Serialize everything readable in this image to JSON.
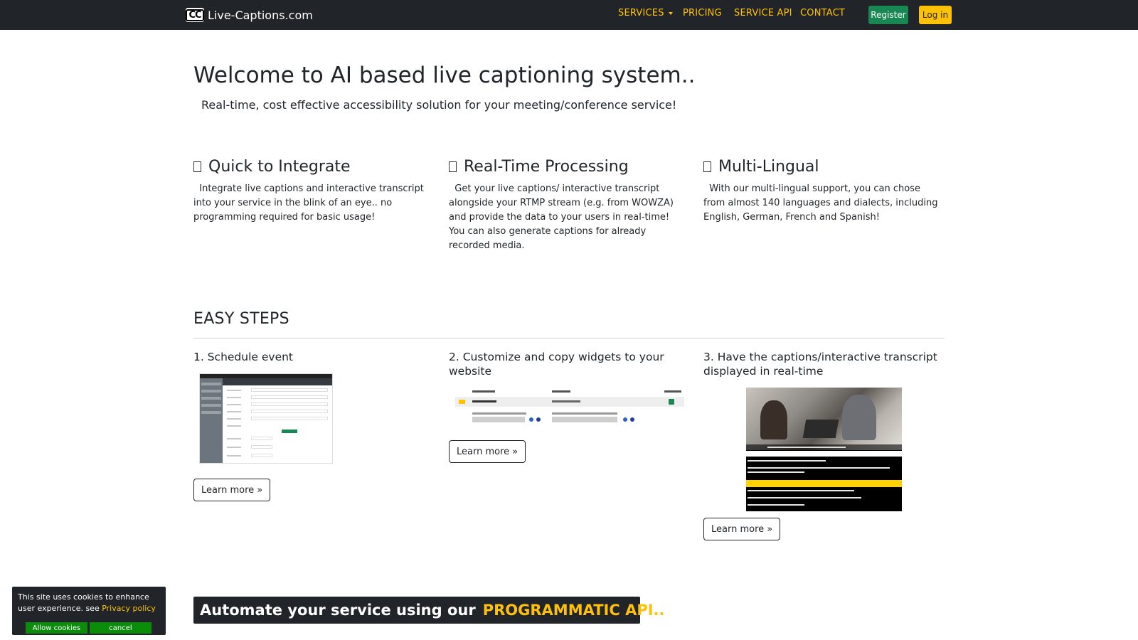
{
  "navbar": {
    "brand_logo": "CC",
    "brand": "Live-Captions.com",
    "links": {
      "services": "SERVICES",
      "pricing": "PRICING",
      "service_api": "SERVICE API",
      "contact": "CONTACT"
    },
    "register": "Register",
    "login": "Log in"
  },
  "hero": {
    "title": "Welcome to AI based live captioning system..",
    "subtitle": "Real-time, cost effective accessibility solution for your meeting/conference service!"
  },
  "features": [
    {
      "title": "Quick to Integrate",
      "text": "  Integrate live captions and interactive transcript into your service in the blink of an eye.. no programming required for basic usage!"
    },
    {
      "title": "Real-Time Processing",
      "text": "  Get your live captions/ interactive transcript alongside your RTMP stream (e.g. from WOWZA) and provide the data to your users in real-time! You can also generate captions for already recorded media."
    },
    {
      "title": "Multi-Lingual",
      "text": "  With our multi-lingual support, you can chose from almost 140 languages and dialects, including English, German, French and Spanish!"
    }
  ],
  "steps": {
    "title": "EASY STEPS",
    "items": [
      {
        "title": "1. Schedule event",
        "button": "Learn more »"
      },
      {
        "title": "2. Customize and copy widgets to your website",
        "button": "Learn more »"
      },
      {
        "title": "3. Have the captions/interactive transcript displayed in real-time",
        "button": "Learn more »"
      }
    ]
  },
  "api_banner": {
    "prefix": "Automate your service using our",
    "highlight": "PROGRAMMATIC API.."
  },
  "cookie": {
    "text": "This site uses cookies to enhance user experience. see",
    "link": "Privacy policy",
    "allow": "Allow cookies",
    "cancel": "cancel"
  },
  "colors": {
    "navbar_bg": "#212529",
    "accent": "#ffc107",
    "register_green": "#198754",
    "cookie_green": "#0b8c0b"
  }
}
